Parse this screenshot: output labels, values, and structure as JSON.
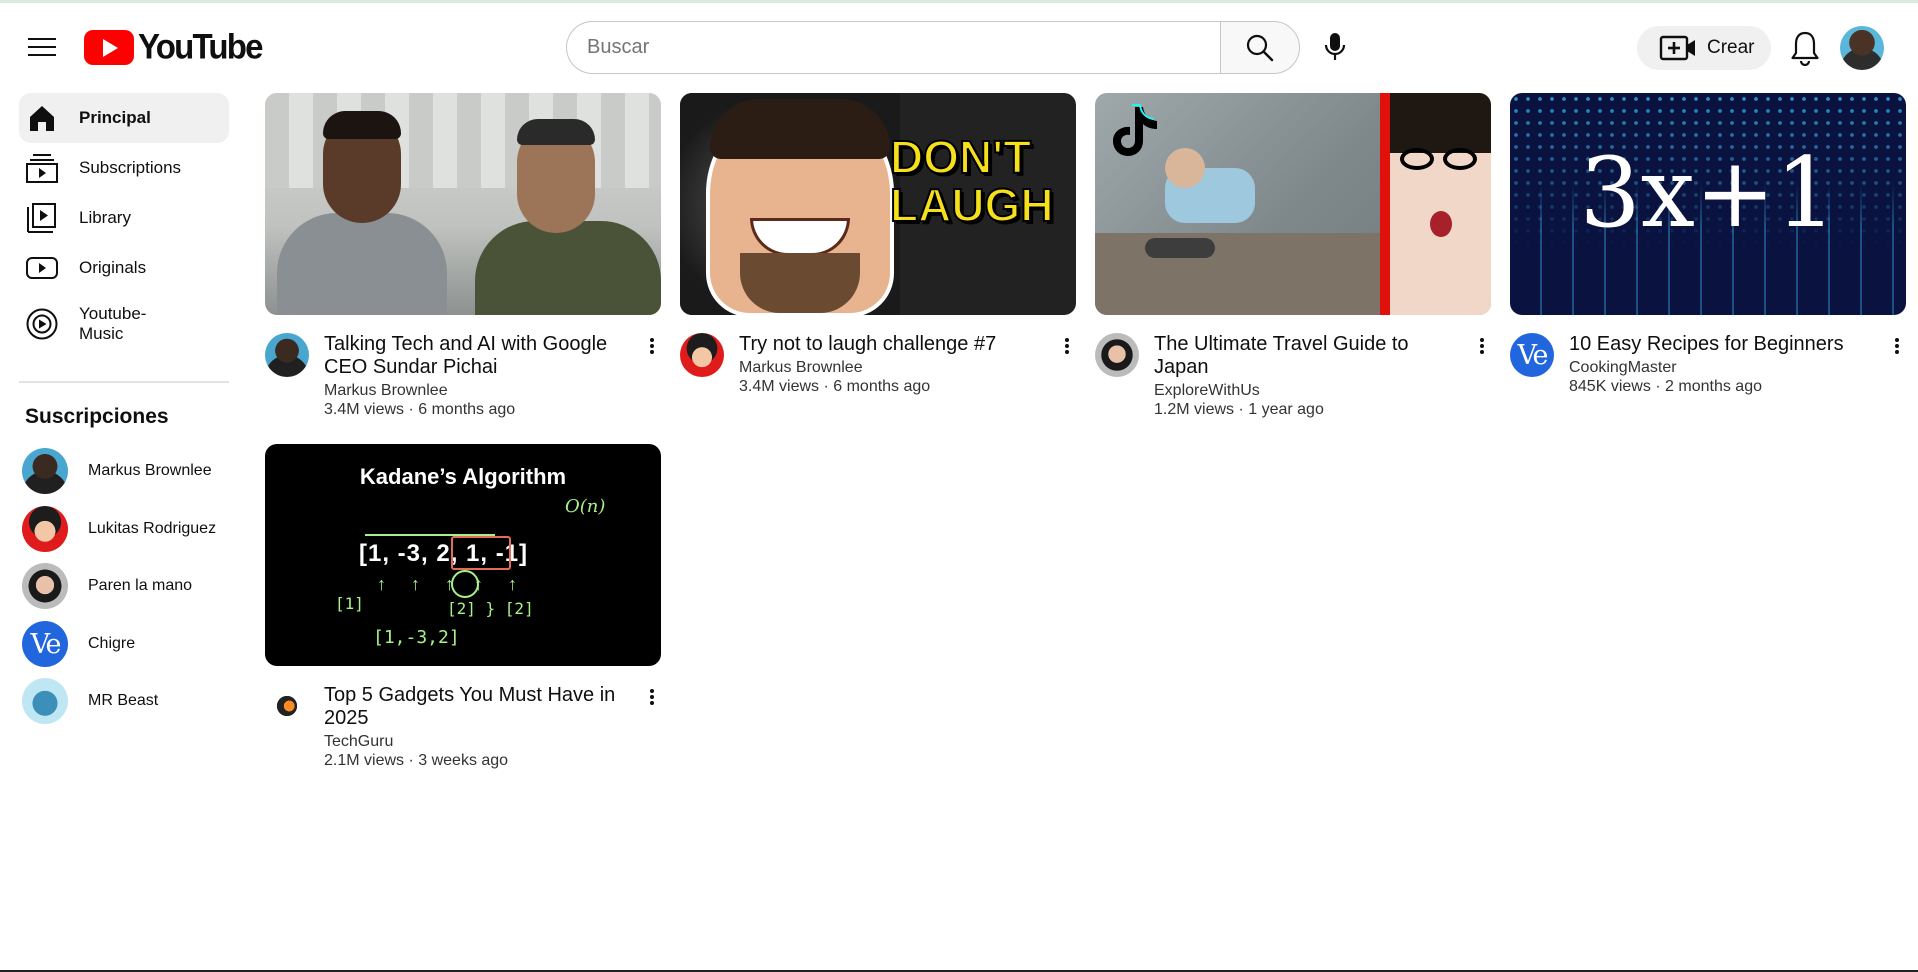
{
  "header": {
    "logo_text": "YouTube",
    "search_placeholder": "Buscar",
    "create_label": "Crear"
  },
  "sidebar": {
    "items": [
      {
        "label": "Principal",
        "icon": "home-icon",
        "active": true
      },
      {
        "label": "Subscriptions",
        "icon": "subscriptions-icon"
      },
      {
        "label": "Library",
        "icon": "library-icon"
      },
      {
        "label": "Originals",
        "icon": "originals-icon"
      },
      {
        "label": "Youtube-Music",
        "icon": "music-icon"
      }
    ],
    "subs_heading": "Suscripciones",
    "subscriptions": [
      {
        "name": "Markus Brownlee"
      },
      {
        "name": "Lukitas Rodriguez"
      },
      {
        "name": "Paren la mano"
      },
      {
        "name": "Chigre"
      },
      {
        "name": "MR Beast"
      }
    ]
  },
  "videos": [
    {
      "title": "Talking Tech and AI with Google CEO Sundar Pichai",
      "channel": "Markus Brownlee",
      "stats": "3.4M views · 6 months ago"
    },
    {
      "title": "Try not to laugh challenge #7",
      "channel": "Markus Brownlee",
      "stats": "3.4M views · 6 months ago",
      "thumb_text": "DON'T LAUGH"
    },
    {
      "title": "The Ultimate Travel Guide to Japan",
      "channel": "ExploreWithUs",
      "stats": "1.2M views · 1 year ago"
    },
    {
      "title": "10 Easy Recipes for Beginners",
      "channel": "CookingMaster",
      "stats": "845K views · 2 months ago",
      "thumb_text": "3x+1"
    },
    {
      "title": "Top 5 Gadgets You Must Have in 2025",
      "channel": "TechGuru",
      "stats": "2.1M views · 3 weeks ago",
      "thumb_text": "Kadane’s Algorithm"
    }
  ],
  "colors": {
    "brand_red": "#ff0000",
    "active_bg": "#f0f0f0",
    "ve_blue": "#2166dc"
  }
}
